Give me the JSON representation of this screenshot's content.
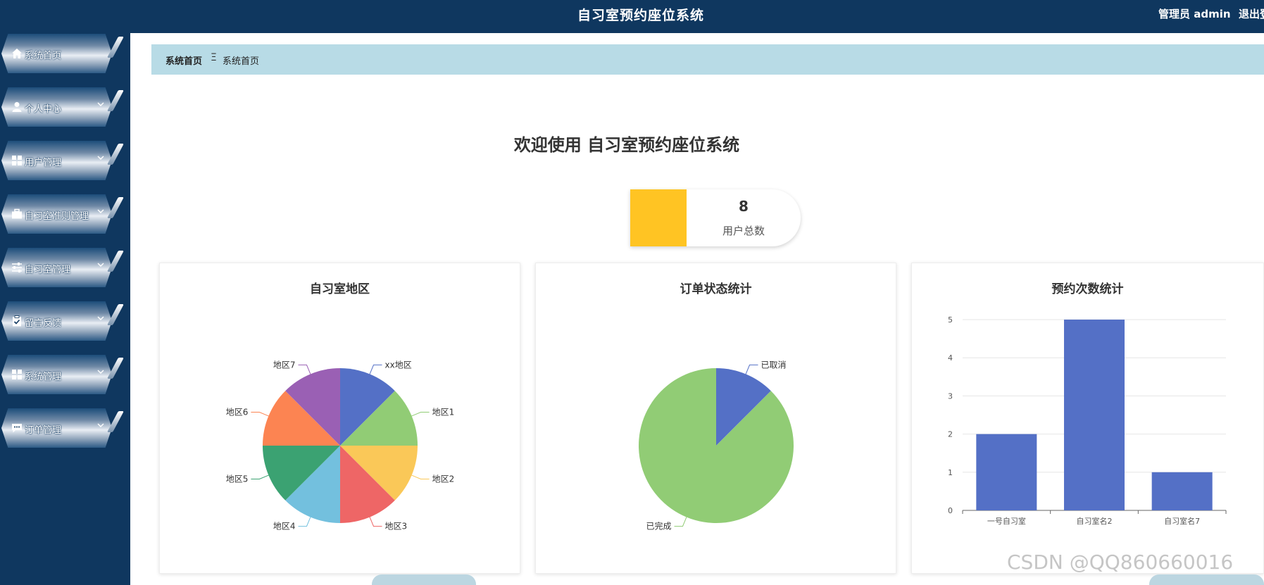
{
  "header": {
    "title": "自习室预约座位系统",
    "user": "管理员 admin",
    "logout": "退出登录"
  },
  "sidebar": {
    "items": [
      {
        "label": "系统首页",
        "icon": "home-icon",
        "has_submenu": false
      },
      {
        "label": "个人中心",
        "icon": "user-icon",
        "has_submenu": true
      },
      {
        "label": "用户管理",
        "icon": "grid-icon",
        "has_submenu": true
      },
      {
        "label": "自习室准则管理",
        "icon": "briefcase-icon",
        "has_submenu": true
      },
      {
        "label": "自习室管理",
        "icon": "sliders-icon",
        "has_submenu": true
      },
      {
        "label": "留言反馈",
        "icon": "clipboard-check-icon",
        "has_submenu": true
      },
      {
        "label": "系统管理",
        "icon": "grid-icon",
        "has_submenu": true
      },
      {
        "label": "订单管理",
        "icon": "chat-icon",
        "has_submenu": true
      }
    ]
  },
  "breadcrumb": {
    "home": "系统首页",
    "separator": "Ξ",
    "current": "系统首页"
  },
  "welcome": "欢迎使用 自习室预约座位系统",
  "stat": {
    "value": "8",
    "label": "用户总数",
    "color": "#ffc423"
  },
  "colors": {
    "nav_bg": "#0f375f",
    "breadcrumb_bg": "#b8dbe6",
    "bar": "#5470c6"
  },
  "panels": [
    {
      "title": "自习室地区"
    },
    {
      "title": "订单状态统计"
    },
    {
      "title": "预约次数统计"
    }
  ],
  "chart_data": [
    {
      "type": "pie",
      "title": "自习室地区",
      "categories": [
        "xx地区",
        "地区1",
        "地区2",
        "地区3",
        "地区4",
        "地区5",
        "地区6",
        "地区7"
      ],
      "values": [
        1,
        1,
        1,
        1,
        1,
        1,
        1,
        1
      ],
      "colors": [
        "#5470c6",
        "#91cc75",
        "#fac858",
        "#ee6666",
        "#73c0de",
        "#3ba272",
        "#fc8452",
        "#9a60b4"
      ]
    },
    {
      "type": "pie",
      "title": "订单状态统计",
      "categories": [
        "已取消",
        "已完成"
      ],
      "values": [
        1,
        7
      ],
      "colors": [
        "#5470c6",
        "#91cc75"
      ]
    },
    {
      "type": "bar",
      "title": "预约次数统计",
      "categories": [
        "一号自习室",
        "自习室名2",
        "自习室名7"
      ],
      "values": [
        2,
        5,
        1
      ],
      "ylim": [
        0,
        5
      ],
      "yticks": [
        0,
        1,
        2,
        3,
        4,
        5
      ],
      "grid": true
    }
  ],
  "watermark": "CSDN @QQ860660016"
}
